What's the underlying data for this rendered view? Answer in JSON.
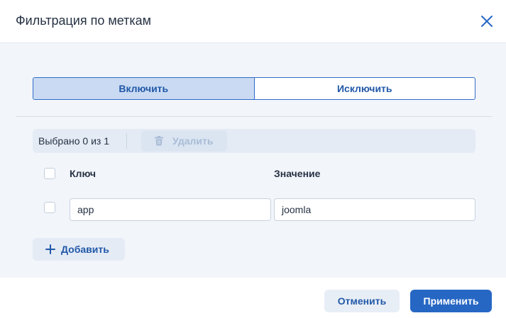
{
  "dialog": {
    "title": "Фильтрация по меткам",
    "close_icon": "close-icon"
  },
  "mode": {
    "options": [
      "Включить",
      "Исключить"
    ],
    "selected": "Включить"
  },
  "toolbar": {
    "selection_text": "Выбрано 0 из 1",
    "delete_label": "Удалить",
    "delete_icon": "trash-icon",
    "delete_enabled": false
  },
  "table": {
    "columns": [
      "Ключ",
      "Значение"
    ],
    "rows": [
      {
        "key": "app",
        "value": "joomla",
        "checked": false
      }
    ]
  },
  "add_button": {
    "label": "Добавить",
    "icon": "plus-icon"
  },
  "footer": {
    "cancel_label": "Отменить",
    "apply_label": "Применить"
  },
  "colors": {
    "accent": "#2667c4",
    "active_segment": "#c9daf2",
    "body_background": "#f2f5fa"
  }
}
